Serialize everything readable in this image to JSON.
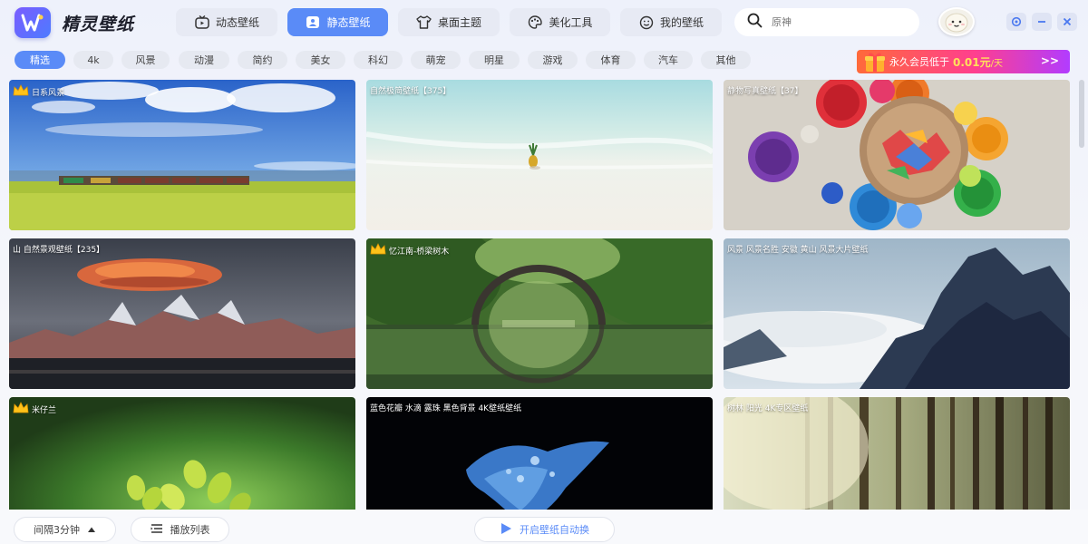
{
  "app": {
    "title": "精灵壁纸"
  },
  "top_tabs": [
    {
      "label": "动态壁纸",
      "icon": "tv-icon"
    },
    {
      "label": "静态壁纸",
      "icon": "image-icon",
      "active": true
    },
    {
      "label": "桌面主题",
      "icon": "shirt-icon"
    },
    {
      "label": "美化工具",
      "icon": "palette-icon"
    },
    {
      "label": "我的壁纸",
      "icon": "smile-icon"
    }
  ],
  "search": {
    "placeholder": "原神"
  },
  "categories": [
    "精选",
    "4k",
    "风景",
    "动漫",
    "简约",
    "美女",
    "科幻",
    "萌宠",
    "明星",
    "游戏",
    "体育",
    "汽车",
    "其他"
  ],
  "vip_banner": {
    "text": "永久会员低于",
    "price": "0.01元",
    "unit": "/天",
    "arrow": ">>"
  },
  "wallpapers": [
    {
      "label": "日系风景",
      "crown": true
    },
    {
      "label": "自然极简壁纸【375】",
      "crown": false
    },
    {
      "label": "静物写真壁纸【37】",
      "crown": false
    },
    {
      "label": "山 自然景观壁纸【235】",
      "crown": false
    },
    {
      "label": "忆江南-桥梁树木",
      "crown": true
    },
    {
      "label": "风景 风景名胜 安徽 黄山 风景大片壁纸",
      "crown": false
    },
    {
      "label": "米仔兰",
      "crown": true
    },
    {
      "label": "蓝色花瓣 水滴 露珠 黑色背景 4K壁纸壁纸",
      "crown": false
    },
    {
      "label": "树林 阳光 4K专区壁纸",
      "crown": false
    }
  ],
  "bottom": {
    "interval_label": "间隔3分钟",
    "playlist_label": "播放列表",
    "autoswitch_label": "开启壁纸自动换"
  },
  "colors": {
    "accent": "#5a8bf7",
    "brand": "#6a5cff"
  }
}
